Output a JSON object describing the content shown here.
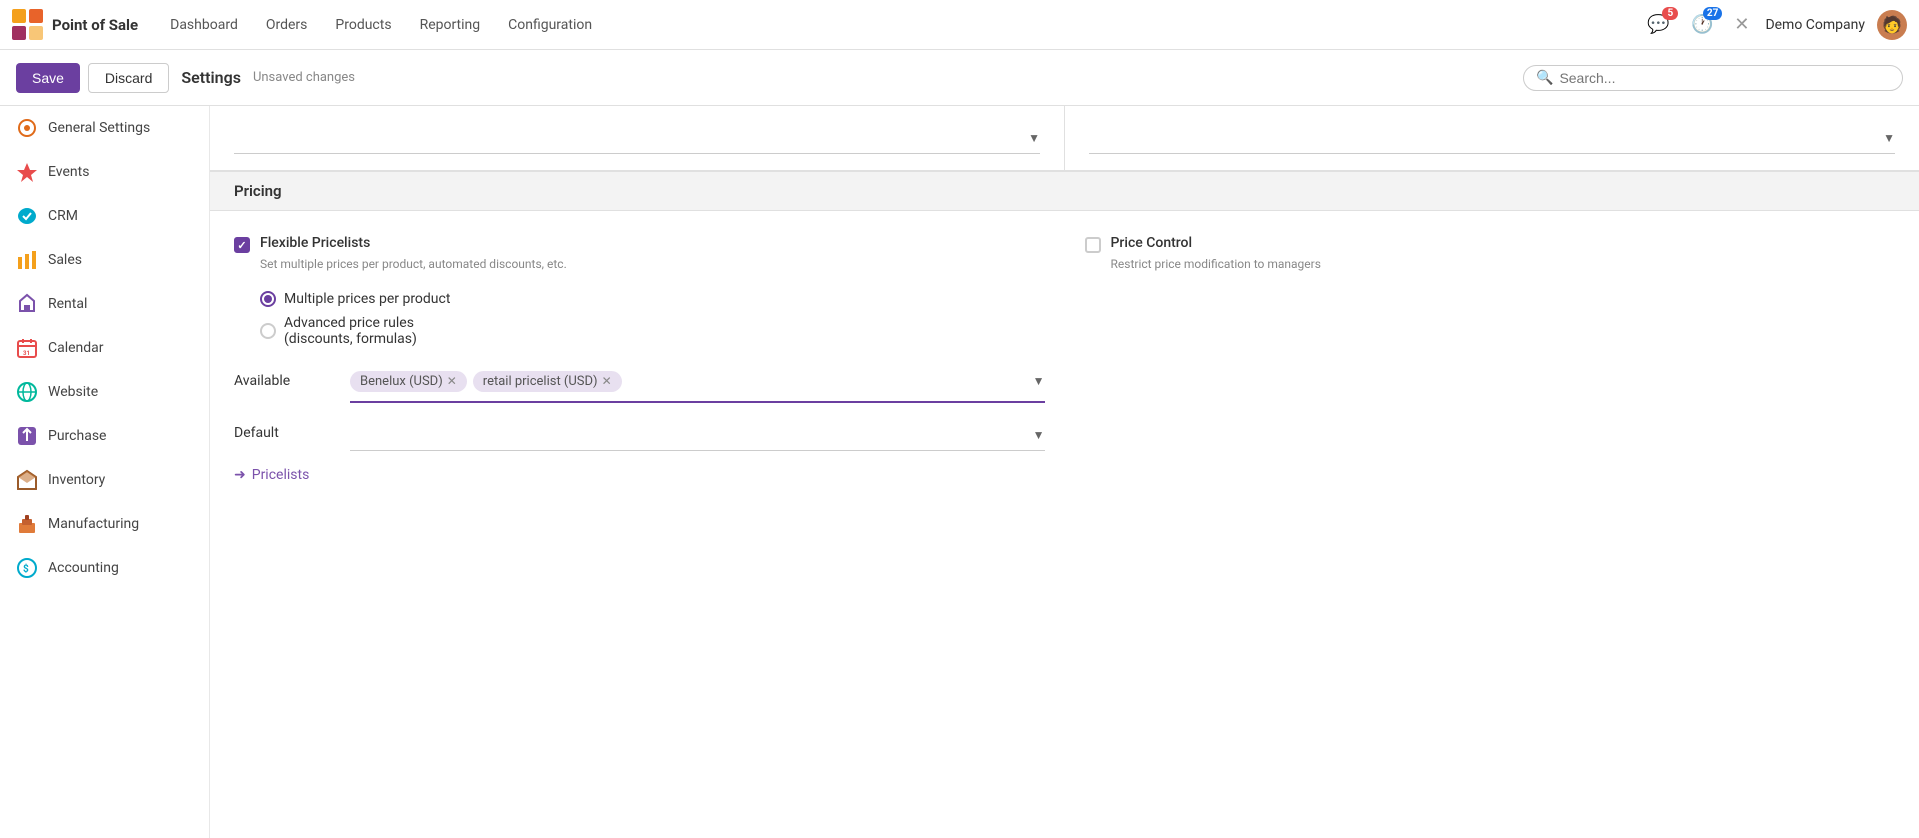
{
  "topNav": {
    "appName": "Point of Sale",
    "links": [
      "Dashboard",
      "Orders",
      "Products",
      "Reporting",
      "Configuration"
    ],
    "notifications": {
      "chat": 5,
      "activity": 27
    },
    "company": "Demo Company"
  },
  "actionBar": {
    "save": "Save",
    "discard": "Discard",
    "title": "Settings",
    "unsaved": "Unsaved changes",
    "searchPlaceholder": "Search..."
  },
  "sidebar": {
    "items": [
      {
        "label": "General Settings",
        "icon": "general"
      },
      {
        "label": "Events",
        "icon": "events"
      },
      {
        "label": "CRM",
        "icon": "crm"
      },
      {
        "label": "Sales",
        "icon": "sales"
      },
      {
        "label": "Rental",
        "icon": "rental"
      },
      {
        "label": "Calendar",
        "icon": "calendar"
      },
      {
        "label": "Website",
        "icon": "website"
      },
      {
        "label": "Purchase",
        "icon": "purchase"
      },
      {
        "label": "Inventory",
        "icon": "inventory"
      },
      {
        "label": "Manufacturing",
        "icon": "manufacturing"
      },
      {
        "label": "Accounting",
        "icon": "accounting"
      }
    ]
  },
  "pricing": {
    "sectionTitle": "Pricing",
    "flexiblePricelists": {
      "label": "Flexible Pricelists",
      "desc": "Set multiple prices per product, automated discounts, etc.",
      "checked": true
    },
    "priceControl": {
      "label": "Price Control",
      "desc": "Restrict price modification to managers",
      "checked": false
    },
    "radioOptions": [
      {
        "label": "Multiple prices per product",
        "selected": true
      },
      {
        "label": "Advanced price rules\n(discounts, formulas)",
        "selected": false
      }
    ],
    "available": {
      "label": "Available",
      "tags": [
        "Benelux (USD)",
        "retail pricelist (USD)"
      ]
    },
    "default": {
      "label": "Default"
    },
    "pricelistsLink": "Pricelists"
  }
}
